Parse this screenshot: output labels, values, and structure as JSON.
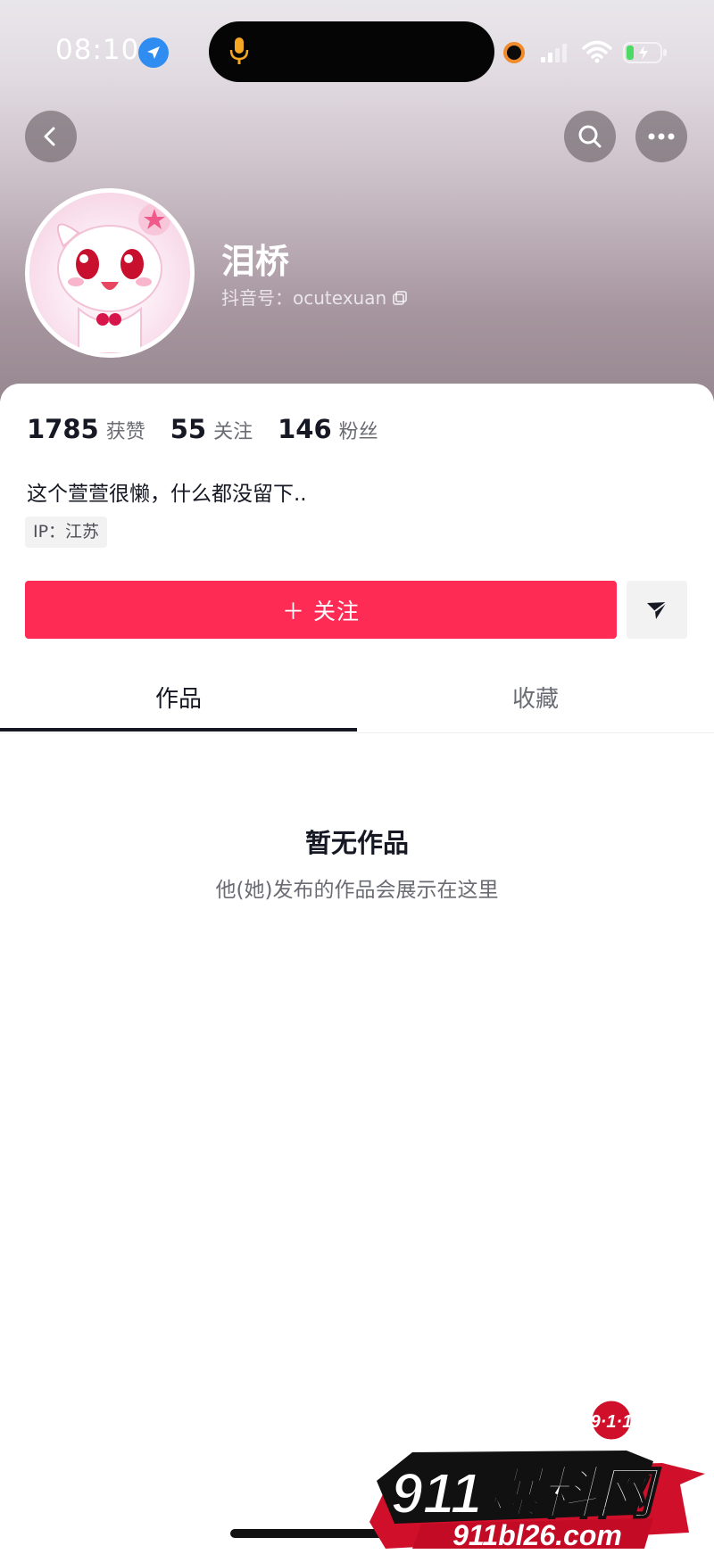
{
  "status_bar": {
    "time": "08:10"
  },
  "profile": {
    "name": "泪桥",
    "id_label": "抖音号：",
    "id_value": "ocutexuan",
    "stats": [
      {
        "num": "1785",
        "label": "获赞"
      },
      {
        "num": "55",
        "label": "关注"
      },
      {
        "num": "146",
        "label": "粉丝"
      }
    ],
    "bio": "这个萱萱很懒，什么都没留下..",
    "ip_tag": "IP：江苏"
  },
  "actions": {
    "follow_label": "＋ 关注"
  },
  "tabs": [
    {
      "label": "作品"
    },
    {
      "label": "收藏"
    }
  ],
  "empty": {
    "title": "暂无作品",
    "subtitle": "他(她)发布的作品会展示在这里"
  },
  "watermark": {
    "top": "9·1·1",
    "brand": "911爆料网",
    "url": "911bl26.com"
  },
  "colors": {
    "accent": "#fe2c55",
    "text": "#161823",
    "muted": "#6b6c73"
  }
}
